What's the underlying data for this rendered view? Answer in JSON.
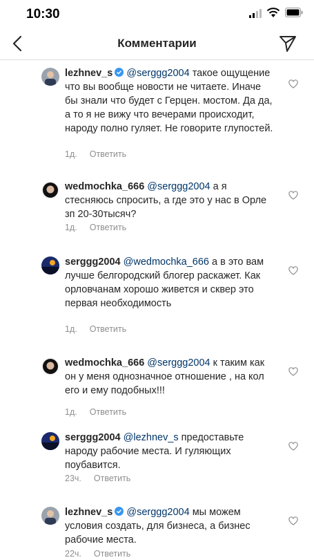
{
  "status_bar": {
    "time": "10:30"
  },
  "header": {
    "title": "Комментарии"
  },
  "comments": [
    {
      "username": "lezhnev_s",
      "verified": true,
      "mention": "@serggg2004",
      "text": " такое ощущение что вы вообще новости не читаете. Иначе бы знали что будет с Герцен. мостом. Да да, а то я не вижу что вечерами происходит, народу полно гуляет. Не говорите глупостей.",
      "time": "1д.",
      "reply": "Ответить"
    },
    {
      "username": "wedmochka_666",
      "verified": false,
      "mention": "@serggg2004",
      "text": " а я стесняюсь  спросить, а где это у нас в Орле зп 20-30тысяч?",
      "time": "1д.",
      "reply": "Ответить"
    },
    {
      "username": "serggg2004",
      "verified": false,
      "mention": "@wedmochka_666",
      "text": " а в это вам лучше белгородский блогер раскажет. Как орловчанам хорошо живется и сквер это первая необходимость",
      "time": "1д.",
      "reply": "Ответить"
    },
    {
      "username": "wedmochka_666",
      "verified": false,
      "mention": "@serggg2004",
      "text": " к таким как он у меня однозначное отношение , на кол его и ему подобных!!!",
      "time": "1д.",
      "reply": "Ответить"
    },
    {
      "username": "serggg2004",
      "verified": false,
      "mention": "@lezhnev_s",
      "text": " предоставьте народу рабочие места. И гуляющих поубавится.",
      "time": "23ч.",
      "reply": "Ответить"
    },
    {
      "username": "lezhnev_s",
      "verified": true,
      "mention": "@serggg2004",
      "text": " мы можем условия создать, для бизнеса, а бизнес рабочие места.",
      "time": "22ч.",
      "reply": "Ответить"
    }
  ],
  "colors": {
    "mention": "#003569",
    "verified": "#3897f0",
    "meta": "#8e8e8e"
  }
}
